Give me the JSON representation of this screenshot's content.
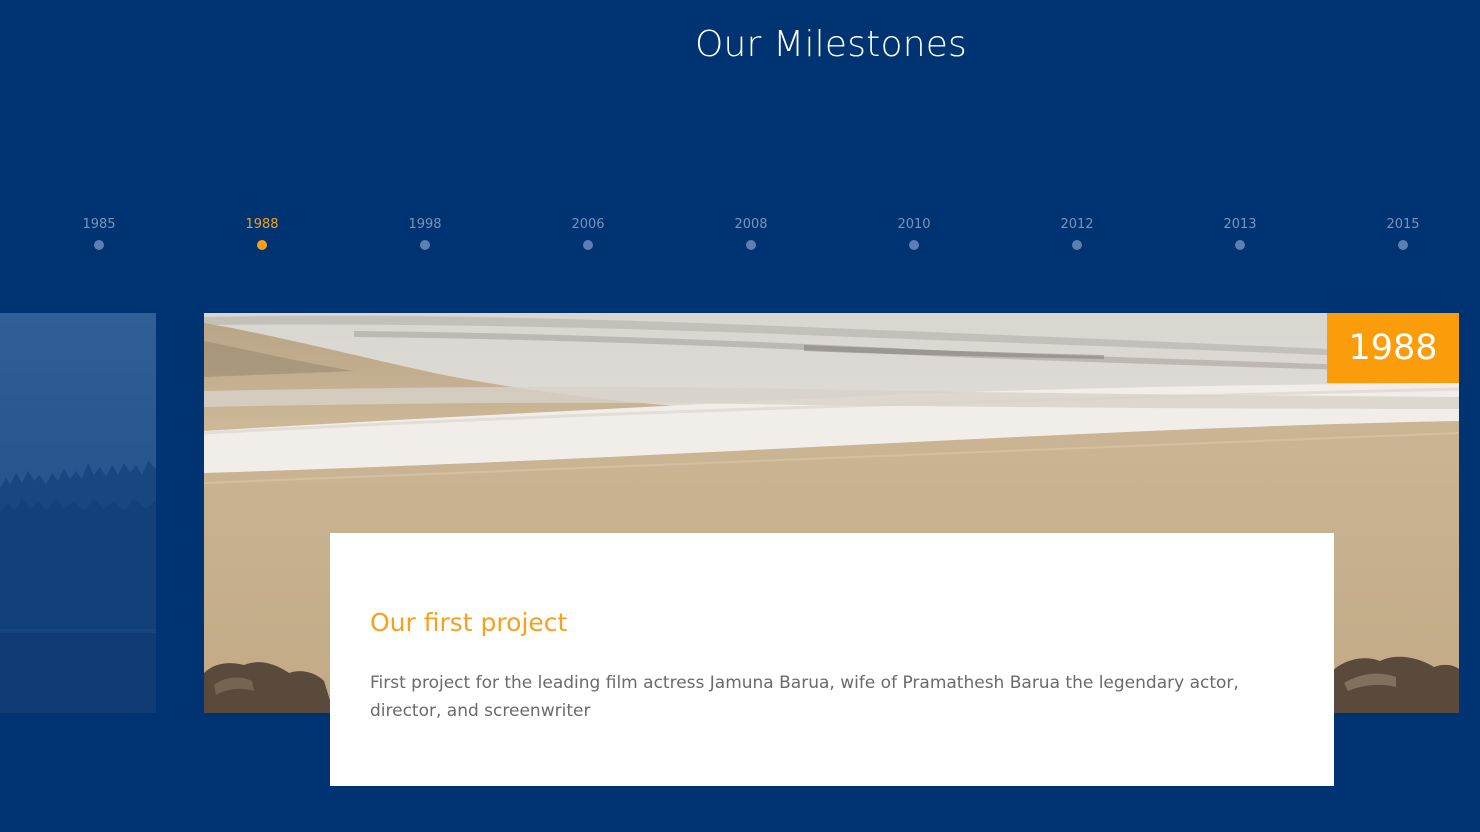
{
  "header": {
    "title": "Our Milestones"
  },
  "timeline": {
    "years": [
      "1985",
      "1988",
      "1998",
      "2006",
      "2008",
      "2010",
      "2012",
      "2013",
      "2015"
    ],
    "active_year": "1988"
  },
  "slide": {
    "year_badge": "1988",
    "title": "Our first project",
    "description": "First project for the leading film actress Jamuna Barua, wife of Pramathesh Barua the legendary actor, director, and screenwriter"
  },
  "colors": {
    "background": "#003371",
    "accent": "#f7a01b",
    "badge": "#fb9d0b",
    "timeline_inactive": "#7a93bd"
  }
}
